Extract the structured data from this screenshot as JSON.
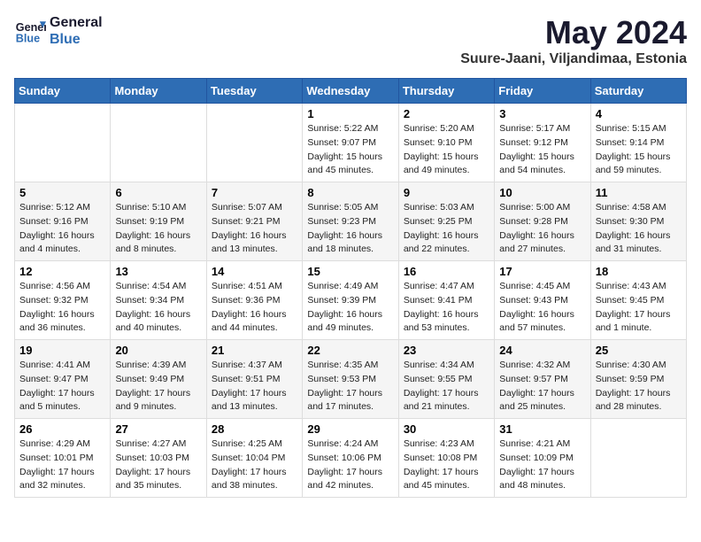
{
  "logo": {
    "line1": "General",
    "line2": "Blue"
  },
  "title": "May 2024",
  "subtitle": "Suure-Jaani, Viljandimaa, Estonia",
  "days_of_week": [
    "Sunday",
    "Monday",
    "Tuesday",
    "Wednesday",
    "Thursday",
    "Friday",
    "Saturday"
  ],
  "weeks": [
    [
      {
        "num": "",
        "info": ""
      },
      {
        "num": "",
        "info": ""
      },
      {
        "num": "",
        "info": ""
      },
      {
        "num": "1",
        "info": "Sunrise: 5:22 AM\nSunset: 9:07 PM\nDaylight: 15 hours\nand 45 minutes."
      },
      {
        "num": "2",
        "info": "Sunrise: 5:20 AM\nSunset: 9:10 PM\nDaylight: 15 hours\nand 49 minutes."
      },
      {
        "num": "3",
        "info": "Sunrise: 5:17 AM\nSunset: 9:12 PM\nDaylight: 15 hours\nand 54 minutes."
      },
      {
        "num": "4",
        "info": "Sunrise: 5:15 AM\nSunset: 9:14 PM\nDaylight: 15 hours\nand 59 minutes."
      }
    ],
    [
      {
        "num": "5",
        "info": "Sunrise: 5:12 AM\nSunset: 9:16 PM\nDaylight: 16 hours\nand 4 minutes."
      },
      {
        "num": "6",
        "info": "Sunrise: 5:10 AM\nSunset: 9:19 PM\nDaylight: 16 hours\nand 8 minutes."
      },
      {
        "num": "7",
        "info": "Sunrise: 5:07 AM\nSunset: 9:21 PM\nDaylight: 16 hours\nand 13 minutes."
      },
      {
        "num": "8",
        "info": "Sunrise: 5:05 AM\nSunset: 9:23 PM\nDaylight: 16 hours\nand 18 minutes."
      },
      {
        "num": "9",
        "info": "Sunrise: 5:03 AM\nSunset: 9:25 PM\nDaylight: 16 hours\nand 22 minutes."
      },
      {
        "num": "10",
        "info": "Sunrise: 5:00 AM\nSunset: 9:28 PM\nDaylight: 16 hours\nand 27 minutes."
      },
      {
        "num": "11",
        "info": "Sunrise: 4:58 AM\nSunset: 9:30 PM\nDaylight: 16 hours\nand 31 minutes."
      }
    ],
    [
      {
        "num": "12",
        "info": "Sunrise: 4:56 AM\nSunset: 9:32 PM\nDaylight: 16 hours\nand 36 minutes."
      },
      {
        "num": "13",
        "info": "Sunrise: 4:54 AM\nSunset: 9:34 PM\nDaylight: 16 hours\nand 40 minutes."
      },
      {
        "num": "14",
        "info": "Sunrise: 4:51 AM\nSunset: 9:36 PM\nDaylight: 16 hours\nand 44 minutes."
      },
      {
        "num": "15",
        "info": "Sunrise: 4:49 AM\nSunset: 9:39 PM\nDaylight: 16 hours\nand 49 minutes."
      },
      {
        "num": "16",
        "info": "Sunrise: 4:47 AM\nSunset: 9:41 PM\nDaylight: 16 hours\nand 53 minutes."
      },
      {
        "num": "17",
        "info": "Sunrise: 4:45 AM\nSunset: 9:43 PM\nDaylight: 16 hours\nand 57 minutes."
      },
      {
        "num": "18",
        "info": "Sunrise: 4:43 AM\nSunset: 9:45 PM\nDaylight: 17 hours\nand 1 minute."
      }
    ],
    [
      {
        "num": "19",
        "info": "Sunrise: 4:41 AM\nSunset: 9:47 PM\nDaylight: 17 hours\nand 5 minutes."
      },
      {
        "num": "20",
        "info": "Sunrise: 4:39 AM\nSunset: 9:49 PM\nDaylight: 17 hours\nand 9 minutes."
      },
      {
        "num": "21",
        "info": "Sunrise: 4:37 AM\nSunset: 9:51 PM\nDaylight: 17 hours\nand 13 minutes."
      },
      {
        "num": "22",
        "info": "Sunrise: 4:35 AM\nSunset: 9:53 PM\nDaylight: 17 hours\nand 17 minutes."
      },
      {
        "num": "23",
        "info": "Sunrise: 4:34 AM\nSunset: 9:55 PM\nDaylight: 17 hours\nand 21 minutes."
      },
      {
        "num": "24",
        "info": "Sunrise: 4:32 AM\nSunset: 9:57 PM\nDaylight: 17 hours\nand 25 minutes."
      },
      {
        "num": "25",
        "info": "Sunrise: 4:30 AM\nSunset: 9:59 PM\nDaylight: 17 hours\nand 28 minutes."
      }
    ],
    [
      {
        "num": "26",
        "info": "Sunrise: 4:29 AM\nSunset: 10:01 PM\nDaylight: 17 hours\nand 32 minutes."
      },
      {
        "num": "27",
        "info": "Sunrise: 4:27 AM\nSunset: 10:03 PM\nDaylight: 17 hours\nand 35 minutes."
      },
      {
        "num": "28",
        "info": "Sunrise: 4:25 AM\nSunset: 10:04 PM\nDaylight: 17 hours\nand 38 minutes."
      },
      {
        "num": "29",
        "info": "Sunrise: 4:24 AM\nSunset: 10:06 PM\nDaylight: 17 hours\nand 42 minutes."
      },
      {
        "num": "30",
        "info": "Sunrise: 4:23 AM\nSunset: 10:08 PM\nDaylight: 17 hours\nand 45 minutes."
      },
      {
        "num": "31",
        "info": "Sunrise: 4:21 AM\nSunset: 10:09 PM\nDaylight: 17 hours\nand 48 minutes."
      },
      {
        "num": "",
        "info": ""
      }
    ]
  ]
}
